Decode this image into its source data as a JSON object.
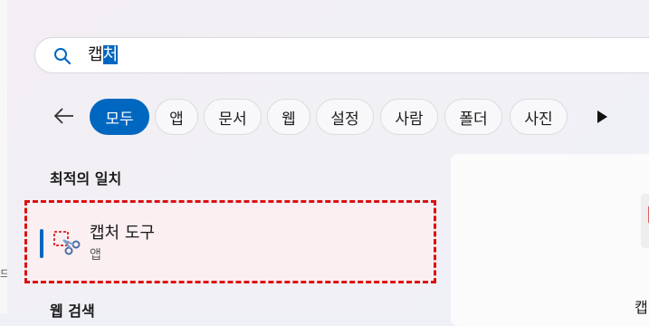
{
  "search": {
    "value_prefix": "캡",
    "value_selected": "처"
  },
  "filters": [
    {
      "label": "모두",
      "active": true
    },
    {
      "label": "앱",
      "active": false
    },
    {
      "label": "문서",
      "active": false
    },
    {
      "label": "웹",
      "active": false
    },
    {
      "label": "설정",
      "active": false
    },
    {
      "label": "사람",
      "active": false
    },
    {
      "label": "폴더",
      "active": false
    },
    {
      "label": "사진",
      "active": false
    }
  ],
  "best_match": {
    "heading": "최적의 일치",
    "title": "캡처 도구",
    "subtitle": "앱"
  },
  "web_search": {
    "heading": "웹 검색"
  },
  "right_panel": {
    "partial_text": "캡"
  },
  "left_strip": {
    "partial_text": "드"
  },
  "colors": {
    "accent": "#0067c0",
    "highlight": "#dd1111"
  }
}
